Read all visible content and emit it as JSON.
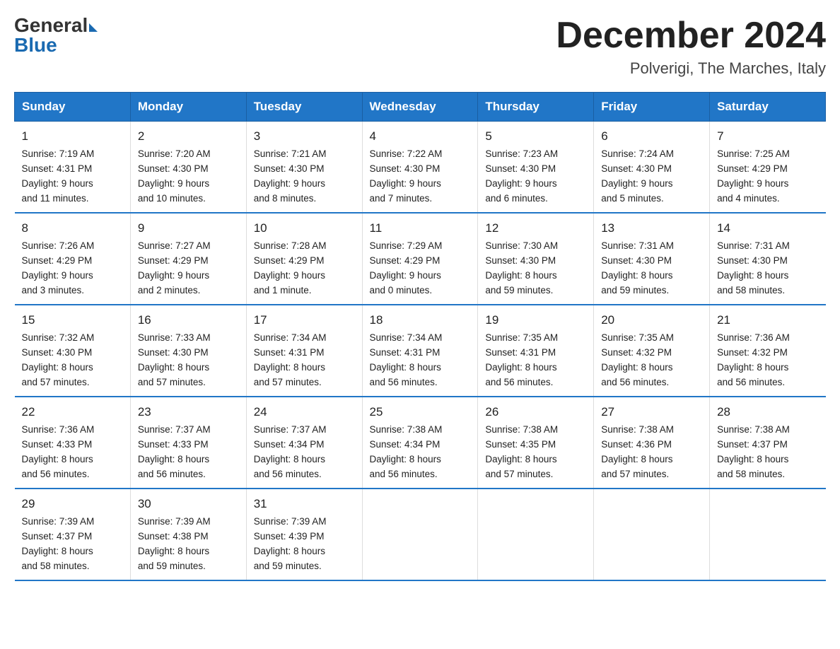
{
  "logo": {
    "general": "General",
    "blue": "Blue"
  },
  "title": "December 2024",
  "location": "Polverigi, The Marches, Italy",
  "days_header": [
    "Sunday",
    "Monday",
    "Tuesday",
    "Wednesday",
    "Thursday",
    "Friday",
    "Saturday"
  ],
  "weeks": [
    [
      {
        "day": "1",
        "info": "Sunrise: 7:19 AM\nSunset: 4:31 PM\nDaylight: 9 hours\nand 11 minutes."
      },
      {
        "day": "2",
        "info": "Sunrise: 7:20 AM\nSunset: 4:30 PM\nDaylight: 9 hours\nand 10 minutes."
      },
      {
        "day": "3",
        "info": "Sunrise: 7:21 AM\nSunset: 4:30 PM\nDaylight: 9 hours\nand 8 minutes."
      },
      {
        "day": "4",
        "info": "Sunrise: 7:22 AM\nSunset: 4:30 PM\nDaylight: 9 hours\nand 7 minutes."
      },
      {
        "day": "5",
        "info": "Sunrise: 7:23 AM\nSunset: 4:30 PM\nDaylight: 9 hours\nand 6 minutes."
      },
      {
        "day": "6",
        "info": "Sunrise: 7:24 AM\nSunset: 4:30 PM\nDaylight: 9 hours\nand 5 minutes."
      },
      {
        "day": "7",
        "info": "Sunrise: 7:25 AM\nSunset: 4:29 PM\nDaylight: 9 hours\nand 4 minutes."
      }
    ],
    [
      {
        "day": "8",
        "info": "Sunrise: 7:26 AM\nSunset: 4:29 PM\nDaylight: 9 hours\nand 3 minutes."
      },
      {
        "day": "9",
        "info": "Sunrise: 7:27 AM\nSunset: 4:29 PM\nDaylight: 9 hours\nand 2 minutes."
      },
      {
        "day": "10",
        "info": "Sunrise: 7:28 AM\nSunset: 4:29 PM\nDaylight: 9 hours\nand 1 minute."
      },
      {
        "day": "11",
        "info": "Sunrise: 7:29 AM\nSunset: 4:29 PM\nDaylight: 9 hours\nand 0 minutes."
      },
      {
        "day": "12",
        "info": "Sunrise: 7:30 AM\nSunset: 4:30 PM\nDaylight: 8 hours\nand 59 minutes."
      },
      {
        "day": "13",
        "info": "Sunrise: 7:31 AM\nSunset: 4:30 PM\nDaylight: 8 hours\nand 59 minutes."
      },
      {
        "day": "14",
        "info": "Sunrise: 7:31 AM\nSunset: 4:30 PM\nDaylight: 8 hours\nand 58 minutes."
      }
    ],
    [
      {
        "day": "15",
        "info": "Sunrise: 7:32 AM\nSunset: 4:30 PM\nDaylight: 8 hours\nand 57 minutes."
      },
      {
        "day": "16",
        "info": "Sunrise: 7:33 AM\nSunset: 4:30 PM\nDaylight: 8 hours\nand 57 minutes."
      },
      {
        "day": "17",
        "info": "Sunrise: 7:34 AM\nSunset: 4:31 PM\nDaylight: 8 hours\nand 57 minutes."
      },
      {
        "day": "18",
        "info": "Sunrise: 7:34 AM\nSunset: 4:31 PM\nDaylight: 8 hours\nand 56 minutes."
      },
      {
        "day": "19",
        "info": "Sunrise: 7:35 AM\nSunset: 4:31 PM\nDaylight: 8 hours\nand 56 minutes."
      },
      {
        "day": "20",
        "info": "Sunrise: 7:35 AM\nSunset: 4:32 PM\nDaylight: 8 hours\nand 56 minutes."
      },
      {
        "day": "21",
        "info": "Sunrise: 7:36 AM\nSunset: 4:32 PM\nDaylight: 8 hours\nand 56 minutes."
      }
    ],
    [
      {
        "day": "22",
        "info": "Sunrise: 7:36 AM\nSunset: 4:33 PM\nDaylight: 8 hours\nand 56 minutes."
      },
      {
        "day": "23",
        "info": "Sunrise: 7:37 AM\nSunset: 4:33 PM\nDaylight: 8 hours\nand 56 minutes."
      },
      {
        "day": "24",
        "info": "Sunrise: 7:37 AM\nSunset: 4:34 PM\nDaylight: 8 hours\nand 56 minutes."
      },
      {
        "day": "25",
        "info": "Sunrise: 7:38 AM\nSunset: 4:34 PM\nDaylight: 8 hours\nand 56 minutes."
      },
      {
        "day": "26",
        "info": "Sunrise: 7:38 AM\nSunset: 4:35 PM\nDaylight: 8 hours\nand 57 minutes."
      },
      {
        "day": "27",
        "info": "Sunrise: 7:38 AM\nSunset: 4:36 PM\nDaylight: 8 hours\nand 57 minutes."
      },
      {
        "day": "28",
        "info": "Sunrise: 7:38 AM\nSunset: 4:37 PM\nDaylight: 8 hours\nand 58 minutes."
      }
    ],
    [
      {
        "day": "29",
        "info": "Sunrise: 7:39 AM\nSunset: 4:37 PM\nDaylight: 8 hours\nand 58 minutes."
      },
      {
        "day": "30",
        "info": "Sunrise: 7:39 AM\nSunset: 4:38 PM\nDaylight: 8 hours\nand 59 minutes."
      },
      {
        "day": "31",
        "info": "Sunrise: 7:39 AM\nSunset: 4:39 PM\nDaylight: 8 hours\nand 59 minutes."
      },
      {
        "day": "",
        "info": ""
      },
      {
        "day": "",
        "info": ""
      },
      {
        "day": "",
        "info": ""
      },
      {
        "day": "",
        "info": ""
      }
    ]
  ]
}
